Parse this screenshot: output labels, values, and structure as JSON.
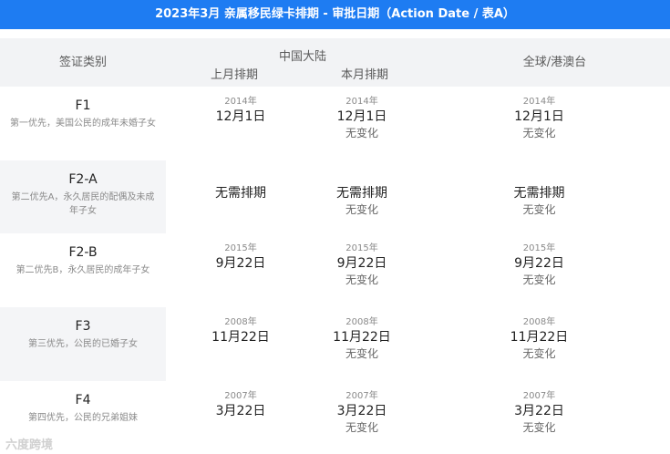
{
  "title": "2023年3月 亲属移民绿卡排期 - 审批日期（Action Date / 表A）",
  "header": {
    "category": "签证类别",
    "mainland_china": "中国大陆",
    "last_month": "上月排期",
    "this_month": "本月排期",
    "global": "全球/港澳台"
  },
  "rows": [
    {
      "code": "F1",
      "desc": "第一优先，美国公民的成年未婚子女",
      "last": {
        "year": "2014年",
        "date": "12月1日"
      },
      "this": {
        "year": "2014年",
        "date": "12月1日",
        "change": "无变化"
      },
      "global": {
        "year": "2014年",
        "date": "12月1日",
        "change": "无变化"
      }
    },
    {
      "code": "F2-A",
      "desc": "第二优先A，永久居民的配偶及未成年子女",
      "last": {
        "date": "无需排期"
      },
      "this": {
        "date": "无需排期",
        "change": "无变化"
      },
      "global": {
        "date": "无需排期",
        "change": "无变化"
      }
    },
    {
      "code": "F2-B",
      "desc": "第二优先B，永久居民的成年子女",
      "last": {
        "year": "2015年",
        "date": "9月22日"
      },
      "this": {
        "year": "2015年",
        "date": "9月22日",
        "change": "无变化"
      },
      "global": {
        "year": "2015年",
        "date": "9月22日",
        "change": "无变化"
      }
    },
    {
      "code": "F3",
      "desc": "第三优先，公民的已婚子女",
      "last": {
        "year": "2008年",
        "date": "11月22日"
      },
      "this": {
        "year": "2008年",
        "date": "11月22日",
        "change": "无变化"
      },
      "global": {
        "year": "2008年",
        "date": "11月22日",
        "change": "无变化"
      }
    },
    {
      "code": "F4",
      "desc": "第四优先，公民的兄弟姐妹",
      "last": {
        "year": "2007年",
        "date": "3月22日"
      },
      "this": {
        "year": "2007年",
        "date": "3月22日",
        "change": "无变化"
      },
      "global": {
        "year": "2007年",
        "date": "3月22日",
        "change": "无变化"
      }
    }
  ],
  "watermark": "六度跨境"
}
